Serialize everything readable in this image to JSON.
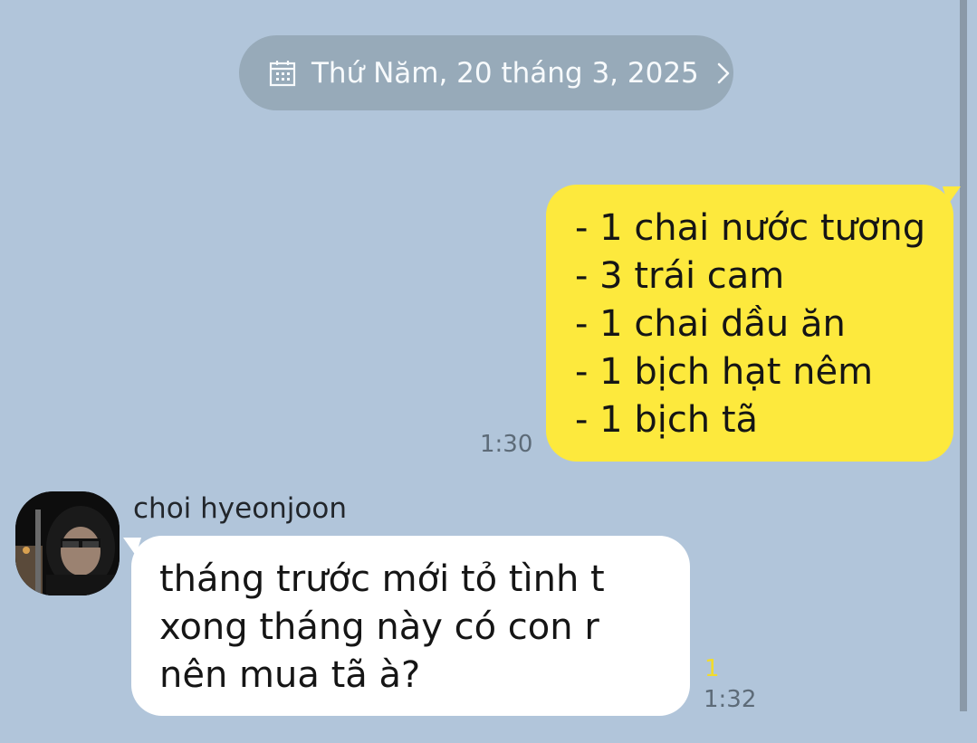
{
  "date_divider": {
    "text": "Thứ Năm, 20 tháng 3, 2025",
    "icon": "calendar-icon",
    "chevron": "chevron-right-icon"
  },
  "outgoing_message": {
    "lines": [
      "- 1 chai nước tương",
      "- 3 trái cam",
      "- 1 chai dầu ăn",
      "- 1 bịch hạt nêm",
      "- 1 bịch tã"
    ],
    "time": "1:30",
    "bubble_color": "#fde93d"
  },
  "incoming_message": {
    "sender": "choi hyeonjoon",
    "lines": [
      "tháng trước mới tỏ tình t",
      "xong tháng này có con r",
      "nên mua tã à?"
    ],
    "unread": "1",
    "time": "1:32",
    "bubble_color": "#ffffff"
  },
  "colors": {
    "background": "#b1c5da",
    "unread": "#f2dc2a"
  }
}
